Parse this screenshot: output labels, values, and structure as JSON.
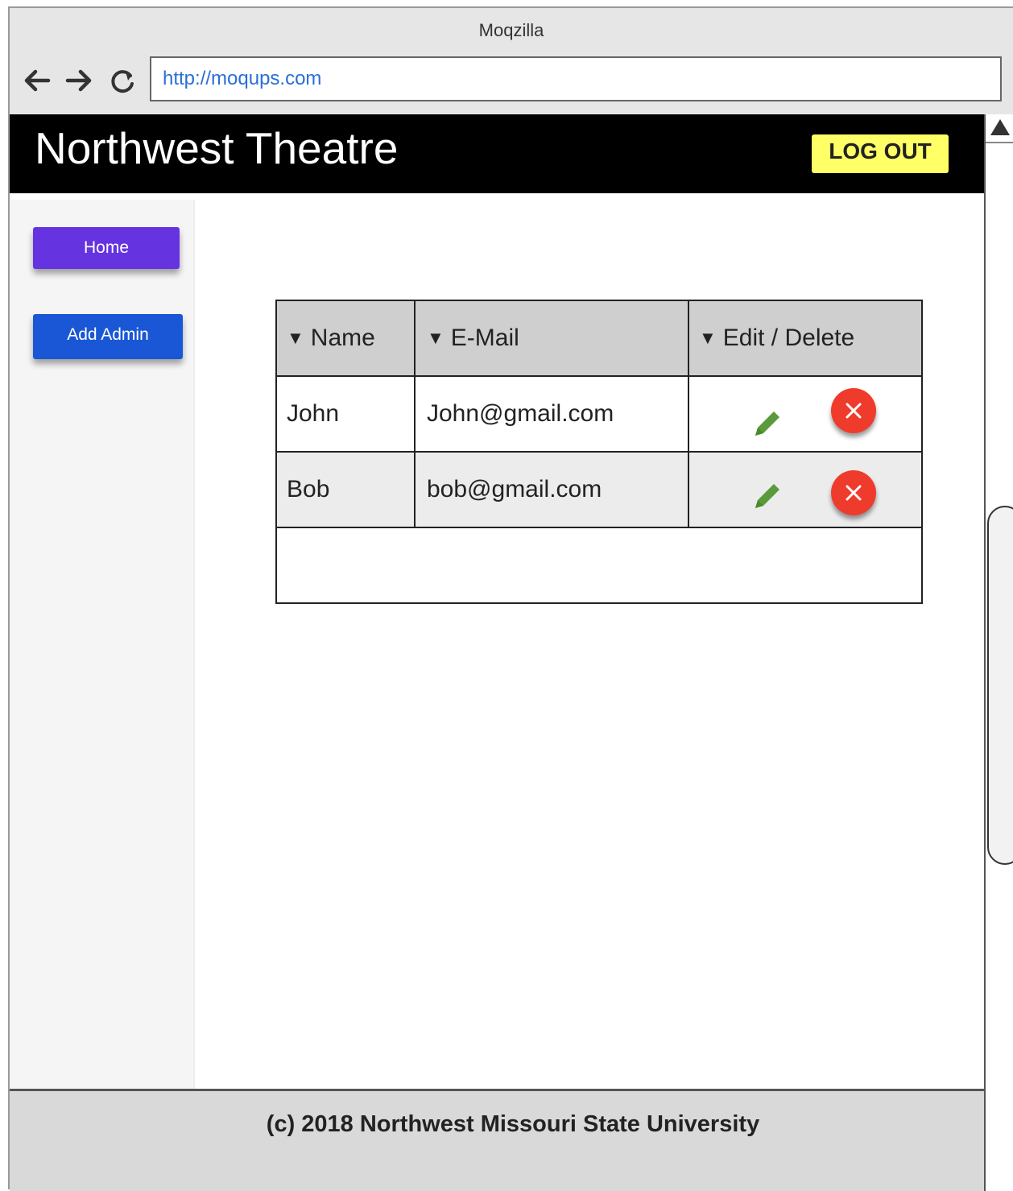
{
  "browser": {
    "title": "Moqzilla",
    "url": "http://moqups.com",
    "back_icon": "arrow-left-icon",
    "forward_icon": "arrow-right-icon",
    "reload_icon": "reload-icon"
  },
  "header": {
    "title": "Northwest Theatre",
    "logout_label": "LOG OUT",
    "logout_color": "#ffff66"
  },
  "sidebar": {
    "items": [
      {
        "label": "Home",
        "color": "#6633e0"
      },
      {
        "label": "Add Admin",
        "color": "#1a57d6"
      }
    ]
  },
  "table": {
    "columns": [
      "Name",
      "E-Mail",
      "Edit / Delete"
    ],
    "rows": [
      {
        "name": "John",
        "email": "John@gmail.com",
        "edit_icon": "pencil-icon",
        "delete_icon": "close-circle-icon"
      },
      {
        "name": "Bob",
        "email": "bob@gmail.com",
        "edit_icon": "pencil-icon",
        "delete_icon": "close-circle-icon"
      }
    ]
  },
  "footer": {
    "text": "(c) 2018 Northwest Missouri State University"
  },
  "colors": {
    "header_bg": "#000000",
    "delete": "#ef3b2c",
    "edit": "#5a9a3a"
  }
}
